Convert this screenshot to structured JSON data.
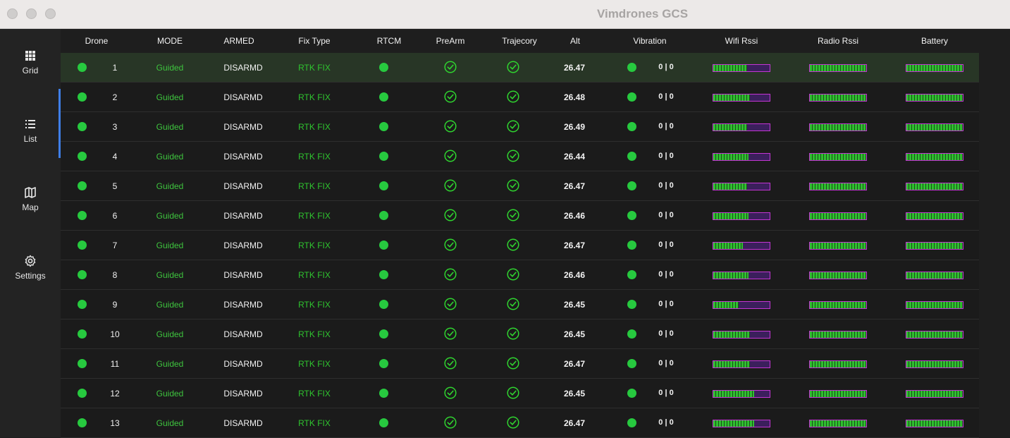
{
  "window": {
    "title": "Vimdrones GCS"
  },
  "sidebar": {
    "items": [
      {
        "label": "Grid",
        "icon": "grid-icon"
      },
      {
        "label": "List",
        "icon": "list-icon",
        "active": true
      },
      {
        "label": "Map",
        "icon": "map-icon"
      },
      {
        "label": "Settings",
        "icon": "gear-icon"
      }
    ]
  },
  "table": {
    "columns": [
      "Drone",
      "MODE",
      "ARMED",
      "Fix Type",
      "RTCM",
      "PreArm",
      "Trajecory",
      "Alt",
      "Vibration",
      "Wifi Rssi",
      "Radio Rssi",
      "Battery"
    ],
    "rows": [
      {
        "drone": "1",
        "mode": "Guided",
        "armed": "DISARMD",
        "fix": "RTK FIX",
        "alt": "26.47",
        "vibration": "0 | 0",
        "wifi": 0.6,
        "radio": 1.0,
        "battery": 1.0
      },
      {
        "drone": "2",
        "mode": "Guided",
        "armed": "DISARMD",
        "fix": "RTK FIX",
        "alt": "26.48",
        "vibration": "0 | 0",
        "wifi": 0.65,
        "radio": 1.0,
        "battery": 1.0
      },
      {
        "drone": "3",
        "mode": "Guided",
        "armed": "DISARMD",
        "fix": "RTK FIX",
        "alt": "26.49",
        "vibration": "0 | 0",
        "wifi": 0.6,
        "radio": 1.0,
        "battery": 1.0
      },
      {
        "drone": "4",
        "mode": "Guided",
        "armed": "DISARMD",
        "fix": "RTK FIX",
        "alt": "26.44",
        "vibration": "0 | 0",
        "wifi": 0.62,
        "radio": 1.0,
        "battery": 1.0
      },
      {
        "drone": "5",
        "mode": "Guided",
        "armed": "DISARMD",
        "fix": "RTK FIX",
        "alt": "26.47",
        "vibration": "0 | 0",
        "wifi": 0.6,
        "radio": 1.0,
        "battery": 1.0
      },
      {
        "drone": "6",
        "mode": "Guided",
        "armed": "DISARMD",
        "fix": "RTK FIX",
        "alt": "26.46",
        "vibration": "0 | 0",
        "wifi": 0.62,
        "radio": 1.0,
        "battery": 1.0
      },
      {
        "drone": "7",
        "mode": "Guided",
        "armed": "DISARMD",
        "fix": "RTK FIX",
        "alt": "26.47",
        "vibration": "0 | 0",
        "wifi": 0.52,
        "radio": 1.0,
        "battery": 1.0
      },
      {
        "drone": "8",
        "mode": "Guided",
        "armed": "DISARMD",
        "fix": "RTK FIX",
        "alt": "26.46",
        "vibration": "0 | 0",
        "wifi": 0.62,
        "radio": 1.0,
        "battery": 1.0
      },
      {
        "drone": "9",
        "mode": "Guided",
        "armed": "DISARMD",
        "fix": "RTK FIX",
        "alt": "26.45",
        "vibration": "0 | 0",
        "wifi": 0.45,
        "radio": 1.0,
        "battery": 1.0
      },
      {
        "drone": "10",
        "mode": "Guided",
        "armed": "DISARMD",
        "fix": "RTK FIX",
        "alt": "26.45",
        "vibration": "0 | 0",
        "wifi": 0.65,
        "radio": 1.0,
        "battery": 1.0
      },
      {
        "drone": "11",
        "mode": "Guided",
        "armed": "DISARMD",
        "fix": "RTK FIX",
        "alt": "26.47",
        "vibration": "0 | 0",
        "wifi": 0.65,
        "radio": 1.0,
        "battery": 1.0
      },
      {
        "drone": "12",
        "mode": "Guided",
        "armed": "DISARMD",
        "fix": "RTK FIX",
        "alt": "26.45",
        "vibration": "0 | 0",
        "wifi": 0.72,
        "radio": 1.0,
        "battery": 1.0
      },
      {
        "drone": "13",
        "mode": "Guided",
        "armed": "DISARMD",
        "fix": "RTK FIX",
        "alt": "26.47",
        "vibration": "0 | 0",
        "wifi": 0.72,
        "radio": 1.0,
        "battery": 1.0
      }
    ]
  },
  "colors": {
    "status_green": "#27c93f",
    "mode_green": "#3ec43e",
    "bar_border": "#c335d4",
    "accent_blue": "#3f7fe8"
  }
}
